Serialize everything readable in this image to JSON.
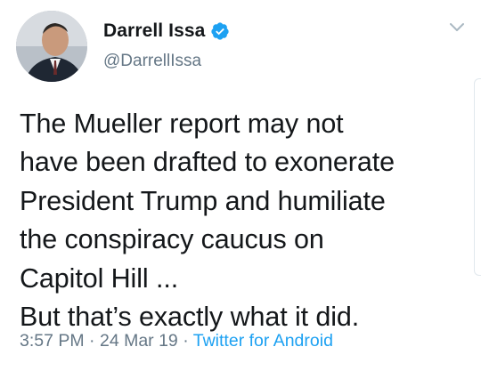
{
  "author": {
    "display_name": "Darrell Issa",
    "handle": "@DarrellIssa",
    "verified": true
  },
  "tweet": {
    "lines": [
      "The Mueller report may not",
      "have been drafted to exonerate",
      "President Trump and humiliate",
      "the conspiracy caucus on",
      "Capitol Hill ...",
      "But that’s exactly what it did."
    ]
  },
  "meta": {
    "time": "3:57 PM",
    "separator": "·",
    "date": "24 Mar 19",
    "source": "Twitter for Android"
  },
  "icons": {
    "verified": "verified-badge-icon",
    "menu": "chevron-down-icon"
  },
  "colors": {
    "text": "#14171a",
    "secondary": "#657786",
    "link": "#1da1f2"
  }
}
